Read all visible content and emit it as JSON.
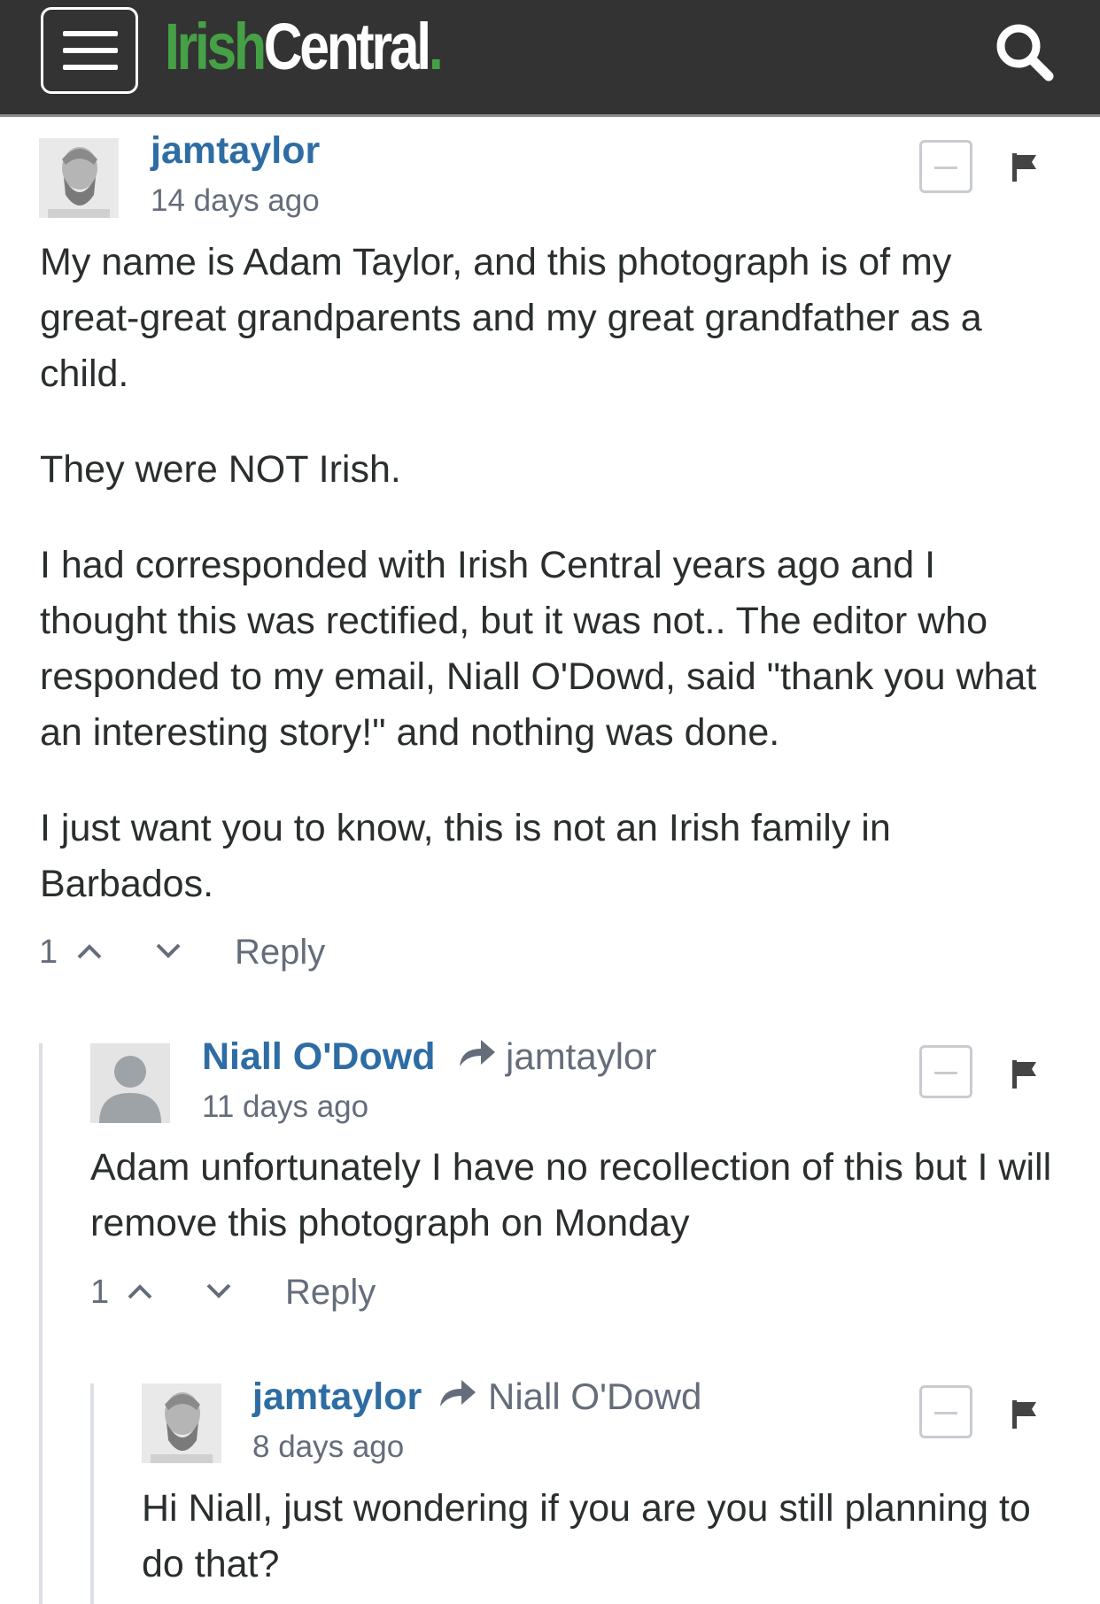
{
  "header": {
    "logo_irish": "Irish",
    "logo_central": "Central",
    "logo_dot": "."
  },
  "comments": [
    {
      "username": "jamtaylor",
      "reply_to": "",
      "timestamp": "14 days ago",
      "paragraphs": [
        "My name is Adam Taylor, and this photograph is of my great-great grandparents and my great grandfather as a child.",
        "They were NOT Irish.",
        "I had corresponded with Irish Central years ago and I thought this was rectified, but it was not.. The editor who responded to my email, Niall O'Dowd, said \"thank you what an interesting story!\" and nothing was done.",
        "I just want you to know, this is not an Irish family in Barbados."
      ],
      "votes": "1",
      "reply_label": "Reply"
    },
    {
      "username": "Niall O'Dowd",
      "reply_to": "jamtaylor",
      "timestamp": "11 days ago",
      "paragraphs": [
        "Adam unfortunately I have no recollection of this but I will remove this photograph on Monday"
      ],
      "votes": "1",
      "reply_label": "Reply"
    },
    {
      "username": "jamtaylor",
      "reply_to": "Niall O'Dowd",
      "timestamp": "8 days ago",
      "paragraphs": [
        "Hi Niall, just wondering if you are you still planning to do that?"
      ]
    }
  ],
  "icons": {
    "menu": "hamburger-menu-icon",
    "search": "search-icon",
    "collapse": "minus-icon",
    "flag": "flag-icon",
    "reply_arrow": "reply-arrow-icon",
    "vote_up": "chevron-up-icon",
    "vote_down": "chevron-down-icon",
    "avatar_default": "default-user-icon"
  },
  "colors": {
    "header_bg": "#333333",
    "logo_green": "#46a046",
    "username_blue": "#2e6da4",
    "meta_gray": "#656c7a"
  }
}
